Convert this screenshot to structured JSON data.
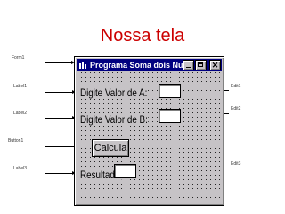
{
  "slide": {
    "title": "Nossa tela"
  },
  "callouts": {
    "form": "Form1",
    "label1": "Label1",
    "label2": "Label2",
    "button": "Button1",
    "label3": "Label3",
    "edit1": "Edit1",
    "edit2": "Edit2",
    "edit3": "Edit3"
  },
  "window": {
    "title": "Programa Soma dois Numeros",
    "minimize_icon": "minimize-icon",
    "maximize_icon": "maximize-icon",
    "close_glyph": "✕"
  },
  "form": {
    "label_a": "Digite Valor de A:",
    "label_b": "Digite Valor de B:",
    "button_label": "Calcula",
    "result_label": "Resultado:",
    "edit_a_value": "",
    "edit_b_value": "",
    "edit_result_value": ""
  },
  "colors": {
    "title": "#cc0000",
    "titlebar": "#000080",
    "form_bg": "#c6c3c6"
  }
}
